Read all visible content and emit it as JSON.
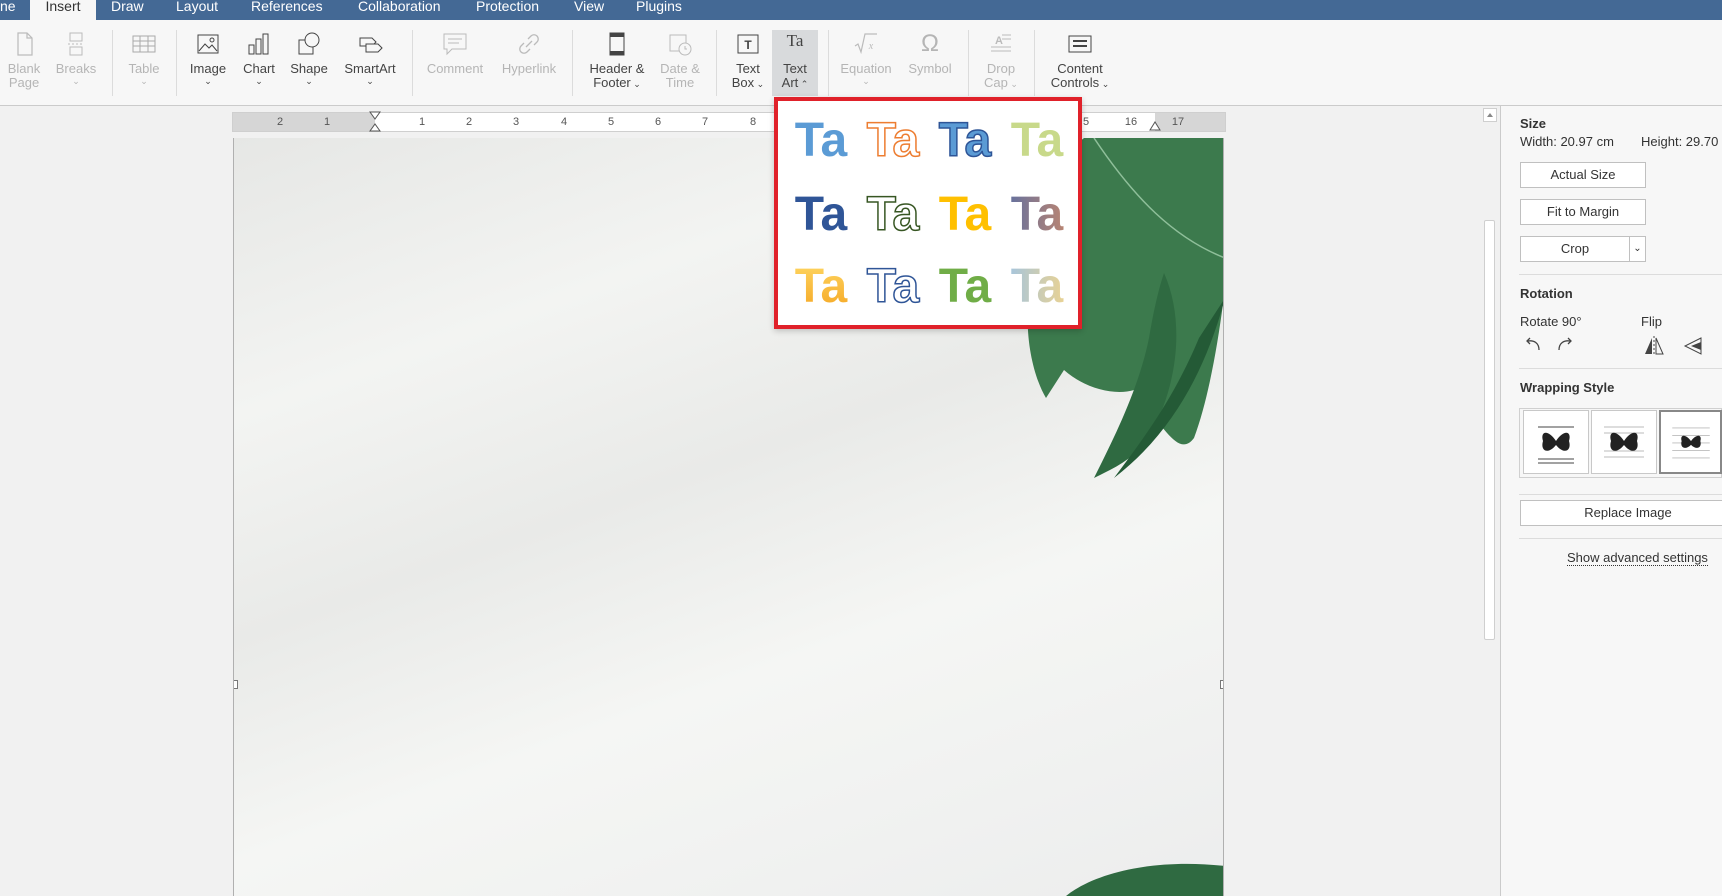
{
  "tabs": [
    {
      "label": "ne",
      "active": false
    },
    {
      "label": "Insert",
      "active": true
    },
    {
      "label": "Draw",
      "active": false
    },
    {
      "label": "Layout",
      "active": false
    },
    {
      "label": "References",
      "active": false
    },
    {
      "label": "Collaboration",
      "active": false
    },
    {
      "label": "Protection",
      "active": false
    },
    {
      "label": "View",
      "active": false
    },
    {
      "label": "Plugins",
      "active": false
    }
  ],
  "toolbar": {
    "blank_page": {
      "line1": "Blank",
      "line2": "Page"
    },
    "breaks": {
      "line1": "Breaks"
    },
    "table": {
      "line1": "Table"
    },
    "image": {
      "line1": "Image"
    },
    "chart": {
      "line1": "Chart"
    },
    "shape": {
      "line1": "Shape"
    },
    "smartart": {
      "line1": "SmartArt"
    },
    "comment": {
      "line1": "Comment"
    },
    "hyperlink": {
      "line1": "Hyperlink"
    },
    "header_footer": {
      "line1": "Header &",
      "line2": "Footer"
    },
    "date_time": {
      "line1": "Date &",
      "line2": "Time"
    },
    "text_box": {
      "line1": "Text",
      "line2": "Box"
    },
    "text_art": {
      "line1": "Text",
      "line2": "Art",
      "icon": "Ta"
    },
    "equation": {
      "line1": "Equation"
    },
    "symbol": {
      "line1": "Symbol"
    },
    "drop_cap": {
      "line1": "Drop",
      "line2": "Cap"
    },
    "content_controls": {
      "line1": "Content",
      "line2": "Controls"
    }
  },
  "ruler": {
    "numbers": [
      "2",
      "1",
      "1",
      "2",
      "3",
      "4",
      "5",
      "6",
      "7",
      "8",
      "5",
      "16",
      "17"
    ]
  },
  "text_art_gallery": {
    "label": "Ta",
    "styles": [
      {
        "fill": "#5b9bd5",
        "stroke": "none"
      },
      {
        "fill": "#ffffff",
        "stroke": "#ed7d31"
      },
      {
        "fill": "#5b9bd5",
        "stroke": "#2e5597"
      },
      {
        "fill": "#c8d98a",
        "stroke": "none"
      },
      {
        "fill": "#2f5597",
        "stroke": "none"
      },
      {
        "fill": "#ffffff",
        "stroke": "#375623"
      },
      {
        "fill": "#ffc000",
        "stroke": "none"
      },
      {
        "fill": "#7f7fa8",
        "stroke": "none"
      },
      {
        "fill": "#ffc000",
        "stroke": "none"
      },
      {
        "fill": "#ffffff",
        "stroke": "#2f5597"
      },
      {
        "fill": "#70ad47",
        "stroke": "none"
      },
      {
        "fill": "#9dc3e6",
        "stroke": "none"
      }
    ]
  },
  "right_panel": {
    "size_heading": "Size",
    "width_text": "Width: 20.97 cm",
    "height_text": "Height: 29.70",
    "actual_size": "Actual Size",
    "fit_to_margin": "Fit to Margin",
    "crop": "Crop",
    "rotation_heading": "Rotation",
    "rotate_label": "Rotate 90°",
    "flip_label": "Flip",
    "wrapping_heading": "Wrapping Style",
    "replace_image": "Replace Image",
    "advanced": "Show advanced settings"
  }
}
